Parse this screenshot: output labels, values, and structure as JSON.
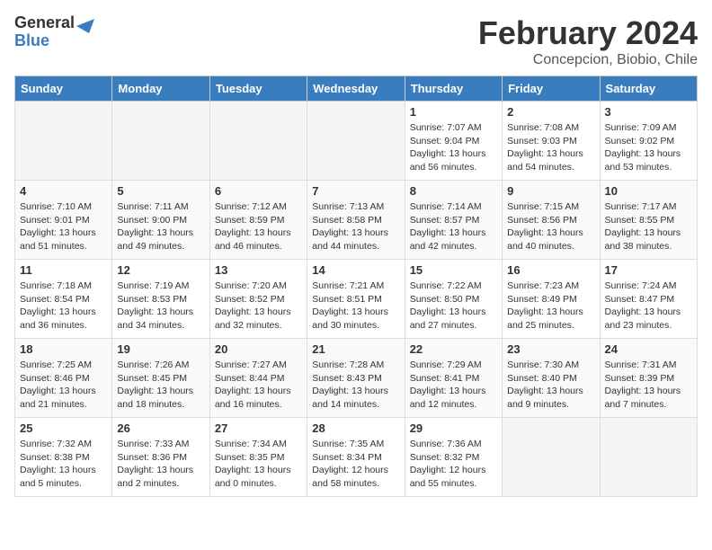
{
  "logo": {
    "text_general": "General",
    "text_blue": "Blue"
  },
  "title": "February 2024",
  "subtitle": "Concepcion, Biobio, Chile",
  "weekdays": [
    "Sunday",
    "Monday",
    "Tuesday",
    "Wednesday",
    "Thursday",
    "Friday",
    "Saturday"
  ],
  "weeks": [
    [
      {
        "day": "",
        "info": ""
      },
      {
        "day": "",
        "info": ""
      },
      {
        "day": "",
        "info": ""
      },
      {
        "day": "",
        "info": ""
      },
      {
        "day": "1",
        "info": "Sunrise: 7:07 AM\nSunset: 9:04 PM\nDaylight: 13 hours\nand 56 minutes."
      },
      {
        "day": "2",
        "info": "Sunrise: 7:08 AM\nSunset: 9:03 PM\nDaylight: 13 hours\nand 54 minutes."
      },
      {
        "day": "3",
        "info": "Sunrise: 7:09 AM\nSunset: 9:02 PM\nDaylight: 13 hours\nand 53 minutes."
      }
    ],
    [
      {
        "day": "4",
        "info": "Sunrise: 7:10 AM\nSunset: 9:01 PM\nDaylight: 13 hours\nand 51 minutes."
      },
      {
        "day": "5",
        "info": "Sunrise: 7:11 AM\nSunset: 9:00 PM\nDaylight: 13 hours\nand 49 minutes."
      },
      {
        "day": "6",
        "info": "Sunrise: 7:12 AM\nSunset: 8:59 PM\nDaylight: 13 hours\nand 46 minutes."
      },
      {
        "day": "7",
        "info": "Sunrise: 7:13 AM\nSunset: 8:58 PM\nDaylight: 13 hours\nand 44 minutes."
      },
      {
        "day": "8",
        "info": "Sunrise: 7:14 AM\nSunset: 8:57 PM\nDaylight: 13 hours\nand 42 minutes."
      },
      {
        "day": "9",
        "info": "Sunrise: 7:15 AM\nSunset: 8:56 PM\nDaylight: 13 hours\nand 40 minutes."
      },
      {
        "day": "10",
        "info": "Sunrise: 7:17 AM\nSunset: 8:55 PM\nDaylight: 13 hours\nand 38 minutes."
      }
    ],
    [
      {
        "day": "11",
        "info": "Sunrise: 7:18 AM\nSunset: 8:54 PM\nDaylight: 13 hours\nand 36 minutes."
      },
      {
        "day": "12",
        "info": "Sunrise: 7:19 AM\nSunset: 8:53 PM\nDaylight: 13 hours\nand 34 minutes."
      },
      {
        "day": "13",
        "info": "Sunrise: 7:20 AM\nSunset: 8:52 PM\nDaylight: 13 hours\nand 32 minutes."
      },
      {
        "day": "14",
        "info": "Sunrise: 7:21 AM\nSunset: 8:51 PM\nDaylight: 13 hours\nand 30 minutes."
      },
      {
        "day": "15",
        "info": "Sunrise: 7:22 AM\nSunset: 8:50 PM\nDaylight: 13 hours\nand 27 minutes."
      },
      {
        "day": "16",
        "info": "Sunrise: 7:23 AM\nSunset: 8:49 PM\nDaylight: 13 hours\nand 25 minutes."
      },
      {
        "day": "17",
        "info": "Sunrise: 7:24 AM\nSunset: 8:47 PM\nDaylight: 13 hours\nand 23 minutes."
      }
    ],
    [
      {
        "day": "18",
        "info": "Sunrise: 7:25 AM\nSunset: 8:46 PM\nDaylight: 13 hours\nand 21 minutes."
      },
      {
        "day": "19",
        "info": "Sunrise: 7:26 AM\nSunset: 8:45 PM\nDaylight: 13 hours\nand 18 minutes."
      },
      {
        "day": "20",
        "info": "Sunrise: 7:27 AM\nSunset: 8:44 PM\nDaylight: 13 hours\nand 16 minutes."
      },
      {
        "day": "21",
        "info": "Sunrise: 7:28 AM\nSunset: 8:43 PM\nDaylight: 13 hours\nand 14 minutes."
      },
      {
        "day": "22",
        "info": "Sunrise: 7:29 AM\nSunset: 8:41 PM\nDaylight: 13 hours\nand 12 minutes."
      },
      {
        "day": "23",
        "info": "Sunrise: 7:30 AM\nSunset: 8:40 PM\nDaylight: 13 hours\nand 9 minutes."
      },
      {
        "day": "24",
        "info": "Sunrise: 7:31 AM\nSunset: 8:39 PM\nDaylight: 13 hours\nand 7 minutes."
      }
    ],
    [
      {
        "day": "25",
        "info": "Sunrise: 7:32 AM\nSunset: 8:38 PM\nDaylight: 13 hours\nand 5 minutes."
      },
      {
        "day": "26",
        "info": "Sunrise: 7:33 AM\nSunset: 8:36 PM\nDaylight: 13 hours\nand 2 minutes."
      },
      {
        "day": "27",
        "info": "Sunrise: 7:34 AM\nSunset: 8:35 PM\nDaylight: 13 hours\nand 0 minutes."
      },
      {
        "day": "28",
        "info": "Sunrise: 7:35 AM\nSunset: 8:34 PM\nDaylight: 12 hours\nand 58 minutes."
      },
      {
        "day": "29",
        "info": "Sunrise: 7:36 AM\nSunset: 8:32 PM\nDaylight: 12 hours\nand 55 minutes."
      },
      {
        "day": "",
        "info": ""
      },
      {
        "day": "",
        "info": ""
      }
    ]
  ]
}
